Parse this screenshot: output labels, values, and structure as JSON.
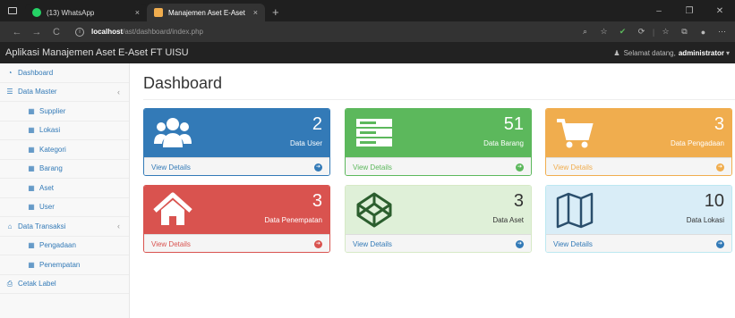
{
  "browser": {
    "tabs": [
      {
        "title": "(13) WhatsApp",
        "close": "×"
      },
      {
        "title": "Manajemen Aset E-Aset",
        "close": "×"
      }
    ],
    "new_tab": "+",
    "window_controls": [
      "–",
      "❐",
      "✕"
    ],
    "nav": {
      "back": "←",
      "forward": "→",
      "reload": "C"
    },
    "url_host": "localhost",
    "url_path": "/ast/dashboard/index.php",
    "info_icon": "i",
    "toolbar_icons": [
      "⌕",
      "☆",
      "✔",
      "⟳",
      "|",
      "☆",
      "⧉",
      "●",
      "⋯"
    ]
  },
  "app": {
    "brand": "Aplikasi Manajemen Aset E-Aset FT UISU",
    "greeting": "Selamat datang,",
    "username": "administrator",
    "user_icon": "♟",
    "dropdown": "▾"
  },
  "sidebar": {
    "items": [
      {
        "label": "Dashboard",
        "icon": "dashboard-icon",
        "glyph": "◔"
      },
      {
        "label": "Data Master",
        "icon": "list-icon",
        "glyph": "☰",
        "chevron": "‹"
      },
      {
        "label": "Supplier",
        "icon": "table-icon",
        "glyph": "▦"
      },
      {
        "label": "Lokasi",
        "icon": "table-icon",
        "glyph": "▦"
      },
      {
        "label": "Kategori",
        "icon": "table-icon",
        "glyph": "▦"
      },
      {
        "label": "Barang",
        "icon": "table-icon",
        "glyph": "▦"
      },
      {
        "label": "Aset",
        "icon": "table-icon",
        "glyph": "▦"
      },
      {
        "label": "User",
        "icon": "table-icon",
        "glyph": "▦"
      },
      {
        "label": "Data Transaksi",
        "icon": "bank-icon",
        "glyph": "⌂",
        "chevron": "‹"
      },
      {
        "label": "Pengadaan",
        "icon": "table-icon",
        "glyph": "▦"
      },
      {
        "label": "Penempatan",
        "icon": "table-icon",
        "glyph": "▦"
      },
      {
        "label": "Cetak Label",
        "icon": "print-icon",
        "glyph": "⎙"
      }
    ]
  },
  "main": {
    "title": "Dashboard",
    "panels": [
      {
        "value": "2",
        "label": "Data User",
        "link": "View Details",
        "arrow": "➔",
        "icon": "users-icon",
        "color": "#337ab7"
      },
      {
        "value": "51",
        "label": "Data Barang",
        "link": "View Details",
        "arrow": "➔",
        "icon": "server-icon",
        "color": "#5cb85c"
      },
      {
        "value": "3",
        "label": "Data Pengadaan",
        "link": "View Details",
        "arrow": "➔",
        "icon": "cart-icon",
        "color": "#f0ad4e"
      },
      {
        "value": "3",
        "label": "Data Penempatan",
        "link": "View Details",
        "arrow": "➔",
        "icon": "home-icon",
        "color": "#d9534f"
      },
      {
        "value": "3",
        "label": "Data Aset",
        "link": "View Details",
        "arrow": "➔",
        "icon": "codepen-icon",
        "color": "#dff0d8"
      },
      {
        "value": "10",
        "label": "Data Lokasi",
        "link": "View Details",
        "arrow": "➔",
        "icon": "map-icon",
        "color": "#d9edf7"
      }
    ]
  }
}
